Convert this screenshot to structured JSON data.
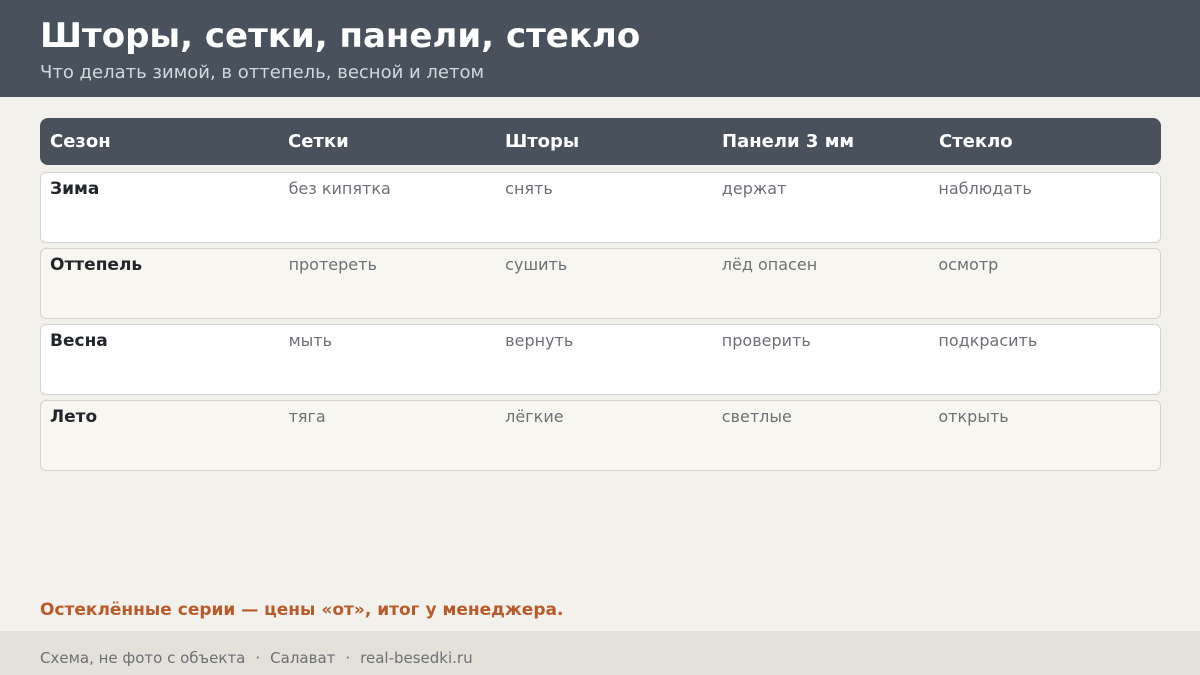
{
  "header": {
    "title": "Шторы, сетки, панели, стекло",
    "subtitle": "Что делать зимой, в оттепель, весной и летом"
  },
  "table": {
    "columns": [
      "Сезон",
      "Сетки",
      "Шторы",
      "Панели 3 мм",
      "Стекло"
    ],
    "rows": [
      [
        "Зима",
        "без кипятка",
        "снять",
        "держат",
        "наблюдать"
      ],
      [
        "Оттепель",
        "протереть",
        "сушить",
        "лёд опасен",
        "осмотр"
      ],
      [
        "Весна",
        "мыть",
        "вернуть",
        "проверить",
        "подкрасить"
      ],
      [
        "Лето",
        "тяга",
        "лёгкие",
        "светлые",
        "открыть"
      ]
    ]
  },
  "note": "Остеклённые серии — цены «от», итог у менеджера.",
  "footer": {
    "items": [
      "Схема, не фото с объекта",
      "Салават",
      "real-besedki.ru"
    ],
    "separator": "·"
  },
  "colors": {
    "header_bg": "#48515c",
    "accent": "#b85b2a",
    "page_bg": "#f3f1ec",
    "footer_bg": "#e4e1db"
  }
}
